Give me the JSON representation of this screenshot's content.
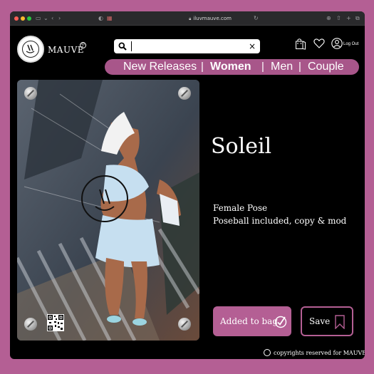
{
  "browser": {
    "url": "iluvmauve.com"
  },
  "header": {
    "brand": "MAUVE",
    "brand_mark": "®",
    "search_value": "",
    "search_clear": "×",
    "logout_label": "Log Out"
  },
  "nav": {
    "items": [
      "New Releases",
      "Women",
      "Men",
      "Couple"
    ],
    "active": "Women",
    "separator": "|"
  },
  "product": {
    "name": "Soleil",
    "description_line1": "Female Pose",
    "description_line2": "Poseball included, copy & mod",
    "image_icon": "product-photo"
  },
  "actions": {
    "added_to_bag_label": "Added to bag",
    "save_label": "Save"
  },
  "footer": {
    "copyright_text": "copyrights reserved for MAUVE."
  },
  "colors": {
    "accent": "#b45f94",
    "nav_bg": "#a8568a",
    "background": "#000000"
  },
  "icons": [
    "search-icon",
    "clear-icon",
    "shopping-bag-icon",
    "heart-icon",
    "user-icon",
    "checkmark-icon",
    "bookmark-icon",
    "copyright-icon"
  ]
}
